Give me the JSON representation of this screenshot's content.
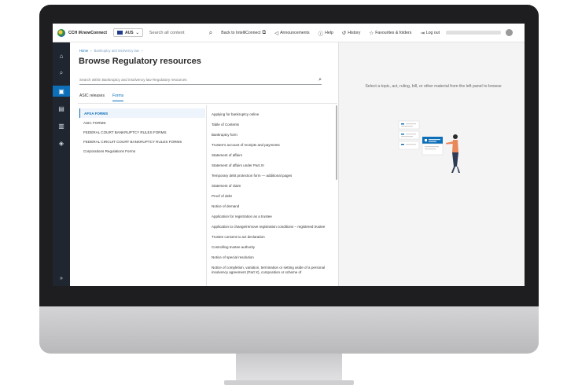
{
  "topbar": {
    "brand": "CCH iKnowConnect",
    "region": "AUS",
    "search_placeholder": "Search all content",
    "links": [
      {
        "label": "Back to IntelliConnect",
        "icon": "external-link-icon"
      },
      {
        "label": "Announcements",
        "icon": "megaphone-icon"
      },
      {
        "label": "Help",
        "icon": "help-icon"
      },
      {
        "label": "History",
        "icon": "history-icon"
      },
      {
        "label": "Favourites & folders",
        "icon": "star-icon"
      },
      {
        "label": "Log out",
        "icon": "logout-icon"
      }
    ]
  },
  "rail": {
    "items": [
      {
        "name": "home-icon"
      },
      {
        "name": "search-icon"
      },
      {
        "name": "briefcase-icon",
        "active": true
      },
      {
        "name": "news-icon"
      },
      {
        "name": "book-icon"
      },
      {
        "name": "documents-icon"
      },
      {
        "name": "expand-icon"
      }
    ]
  },
  "main": {
    "breadcrumb": {
      "home": "Home",
      "current": "Bankruptcy and insolvency law"
    },
    "title": "Browse Regulatory resources",
    "search_placeholder": "Search within Bankruptcy and insolvency law Regulatory resources",
    "tabs": [
      {
        "label": "ASIC releases",
        "active": false
      },
      {
        "label": "Forms",
        "active": true
      }
    ],
    "categories": [
      {
        "label": "AFSA FORMS",
        "active": true
      },
      {
        "label": "ASIC FORMS",
        "active": false
      },
      {
        "label": "FEDERAL COURT BANKRUPTCY RULES FORMS",
        "active": false
      },
      {
        "label": "FEDERAL CIRCUIT COURT BANKRUPTCY RULES FORMS",
        "active": false
      },
      {
        "label": "Corporations Regulations Forms",
        "active": false
      }
    ],
    "forms": [
      "Applying for bankruptcy online",
      "Table of Contents",
      "Bankruptcy form",
      "Trustee's account of receipts and payments",
      "Statement of affairs",
      "Statement of affairs under Part.XI",
      "Temporary debt protection form — additional pages",
      "Statement of claim",
      "Proof of debt",
      "Notice of demand",
      "Application for registration as a trustee",
      "Application to change/remove registration conditions – registered trustee",
      "Trustee consent to act declaration",
      "Controlling trustee authority",
      "Notice of special resolution",
      "Notice of completion, variation, termination or setting aside of a personal insolvency agreement (Part X), composition or scheme of"
    ]
  },
  "right_panel": {
    "message": "Select a topic, act, ruling, bill, or other material from the left panel to browse"
  },
  "colors": {
    "accent": "#0d6fb8",
    "rail_bg": "#1f2630",
    "panel_bg": "#f4f4f4"
  }
}
